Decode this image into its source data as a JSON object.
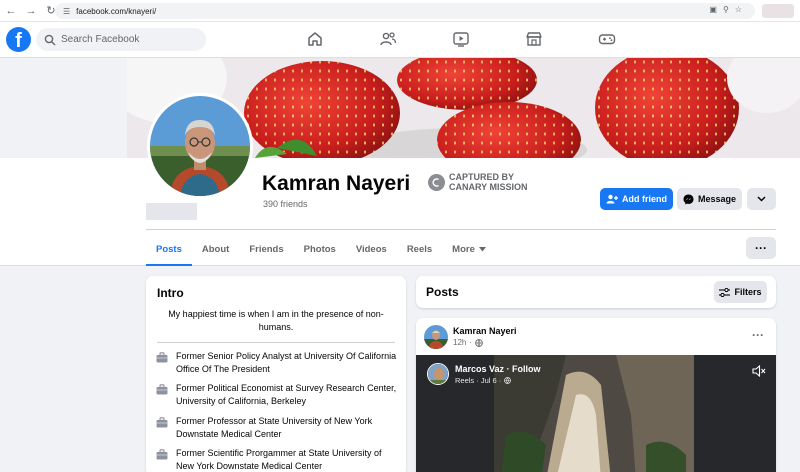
{
  "browser": {
    "url": "facebook.com/knayeri/",
    "nav_icons": [
      "back-icon",
      "forward-icon",
      "reload-icon",
      "site-settings-icon"
    ],
    "right_icons": [
      "install-icon",
      "zoom-icon",
      "bookmark-star-icon"
    ]
  },
  "topbar": {
    "logo": "f",
    "search_placeholder": "Search Facebook",
    "nav_icons": [
      "home-icon",
      "friends-icon",
      "watch-icon",
      "marketplace-icon",
      "gaming-icon"
    ],
    "brand_color": "#1877f2"
  },
  "profile": {
    "name": "Kamran Nayeri",
    "friends": "390 friends",
    "watermark_line1": "CAPTURED BY",
    "watermark_line2": "CANARY MISSION",
    "add_friend_label": "Add friend",
    "message_label": "Message"
  },
  "tabs": [
    {
      "label": "Posts",
      "active": true
    },
    {
      "label": "About",
      "active": false
    },
    {
      "label": "Friends",
      "active": false
    },
    {
      "label": "Photos",
      "active": false
    },
    {
      "label": "Videos",
      "active": false
    },
    {
      "label": "Reels",
      "active": false
    },
    {
      "label": "More",
      "active": false
    }
  ],
  "intro": {
    "title": "Intro",
    "bio": "My happiest time is when I am in the presence of non-humans.",
    "items": [
      {
        "text": "Former Senior Policy Analyst at University Of California Office Of The President"
      },
      {
        "text": "Former Political Economist at Survey Research Center, University of California, Berkeley"
      },
      {
        "text": "Former Professor at State University of New York Downstate Medical Center"
      },
      {
        "text": "Former Scientific Prorgammer at State University of New York Downstate Medical Center"
      }
    ]
  },
  "posts": {
    "title": "Posts",
    "filters_label": "Filters",
    "post": {
      "author": "Kamran Nayeri",
      "time": "12h",
      "reel_author": "Marcos Vaz · Follow",
      "reel_meta": "Reels · Jul 6 ·"
    }
  }
}
